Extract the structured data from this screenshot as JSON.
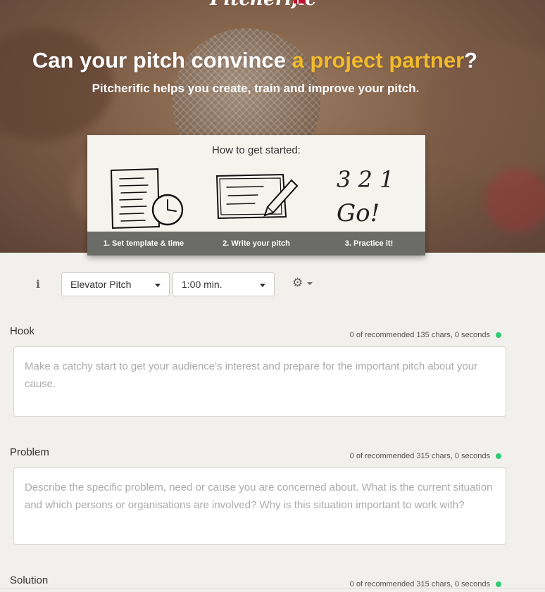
{
  "brand": {
    "logo": "Pitcherific"
  },
  "hero": {
    "headline_prefix": "Can your pitch convince",
    "headline_accent": "a project partner",
    "headline_suffix": "?",
    "subline": "Pitcherific helps you create, train and improve your pitch.",
    "accent_color": "#f2bb2c"
  },
  "howto": {
    "title": "How to get started:",
    "steps": [
      {
        "label": "1. Set template & time",
        "icon": "document-clock-icon"
      },
      {
        "label": "2. Write your pitch",
        "icon": "pen-paper-icon"
      },
      {
        "label": "3. Practice it!",
        "icon": "countdown-go-icon"
      }
    ],
    "countdown_text": "3 2 1",
    "go_text": "Go!"
  },
  "toolbar": {
    "info_glyph": "i",
    "template_select": "Elevator Pitch",
    "time_select": "1:00 min."
  },
  "sections": [
    {
      "label": "Hook",
      "counter": "0 of recommended 135 chars, 0 seconds",
      "placeholder": "Make a catchy start to get your audience's interest and prepare for the important pitch about your cause."
    },
    {
      "label": "Problem",
      "counter": "0 of recommended 315 chars, 0 seconds",
      "placeholder": "Describe the specific problem, need or cause you are concerned about. What is the current situation and which persons or organisations are involved? Why is this situation important to work with?"
    },
    {
      "label": "Solution",
      "counter": "0 of recommended 315 chars, 0 seconds"
    }
  ]
}
